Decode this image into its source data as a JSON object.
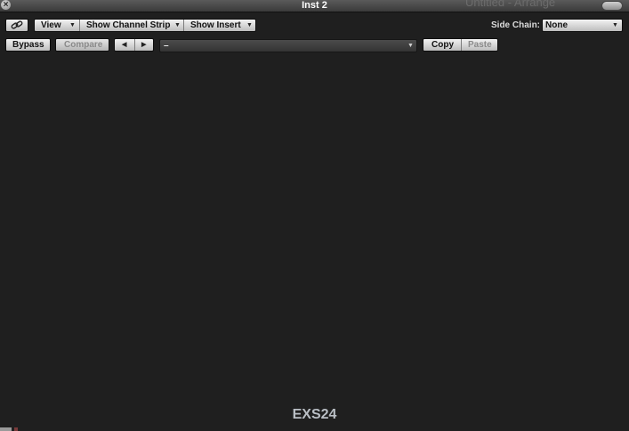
{
  "window": {
    "title": "Inst 2",
    "background_window_title": "Untitled - Arrange"
  },
  "toolbar": {
    "link_icon": "link-icon",
    "view_label": "View",
    "show_channel_strip_label": "Show Channel Strip",
    "show_insert_label": "Show Insert",
    "side_chain_label": "Side Chain:",
    "side_chain_value": "None"
  },
  "controls": {
    "bypass_label": "Bypass",
    "compare_label": "Compare",
    "prev_icon": "triangle-left-icon",
    "next_icon": "triangle-right-icon",
    "preset_value": "–",
    "copy_label": "Copy",
    "paste_label": "Paste"
  },
  "plugin": {
    "name": "EXS24"
  },
  "colors": {
    "window_bg": "#1f1f1f",
    "button_light": "#f2f2f2",
    "footer_text": "#b9bec4"
  }
}
